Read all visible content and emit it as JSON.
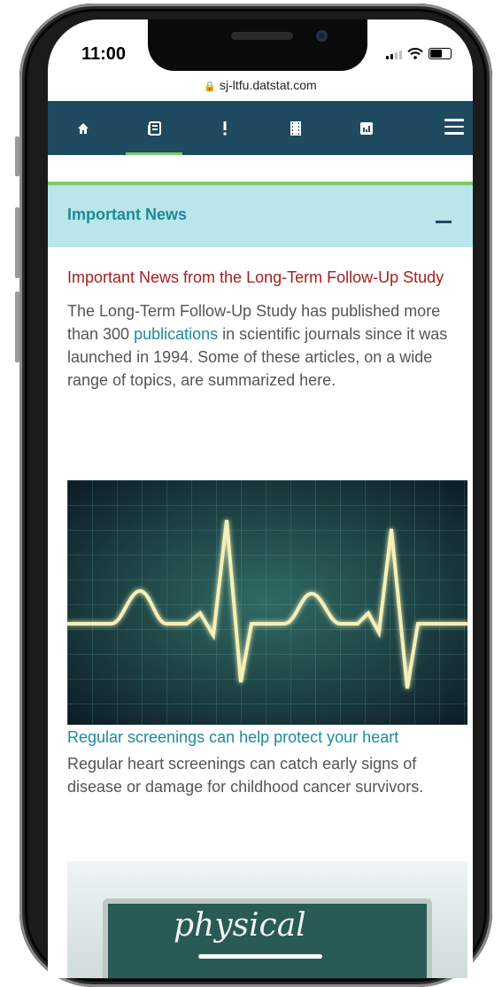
{
  "status": {
    "time": "11:00"
  },
  "browser": {
    "url": "sj-ltfu.datstat.com"
  },
  "nav": {
    "items": [
      {
        "icon": "home-icon"
      },
      {
        "icon": "news-icon",
        "active": true
      },
      {
        "icon": "alert-icon"
      },
      {
        "icon": "film-icon"
      },
      {
        "icon": "chart-icon"
      }
    ],
    "menu_icon": "hamburger-menu-icon"
  },
  "section": {
    "title": "Important News",
    "collapse_icon": "minus-icon"
  },
  "news": {
    "headline": "Important News from the Long-Term Follow-Up Study",
    "intro_before": "The Long-Term Follow-Up Study has published more than 300 ",
    "intro_link": "publications",
    "intro_after": " in scientific journals since it was launched in 1994. Some of these articles, on a wide range of topics, are summarized here."
  },
  "articles": [
    {
      "title": "Regular screenings can help protect your heart",
      "summary": "Regular heart screenings can catch early signs of disease or damage for childhood cancer survivors."
    }
  ],
  "second_image": {
    "board_text": "physical"
  },
  "colors": {
    "nav": "#1f4a60",
    "accent": "#7dc86a",
    "section_bg": "#b8e6ea",
    "headline": "#a41e22",
    "link": "#1d8a99"
  }
}
